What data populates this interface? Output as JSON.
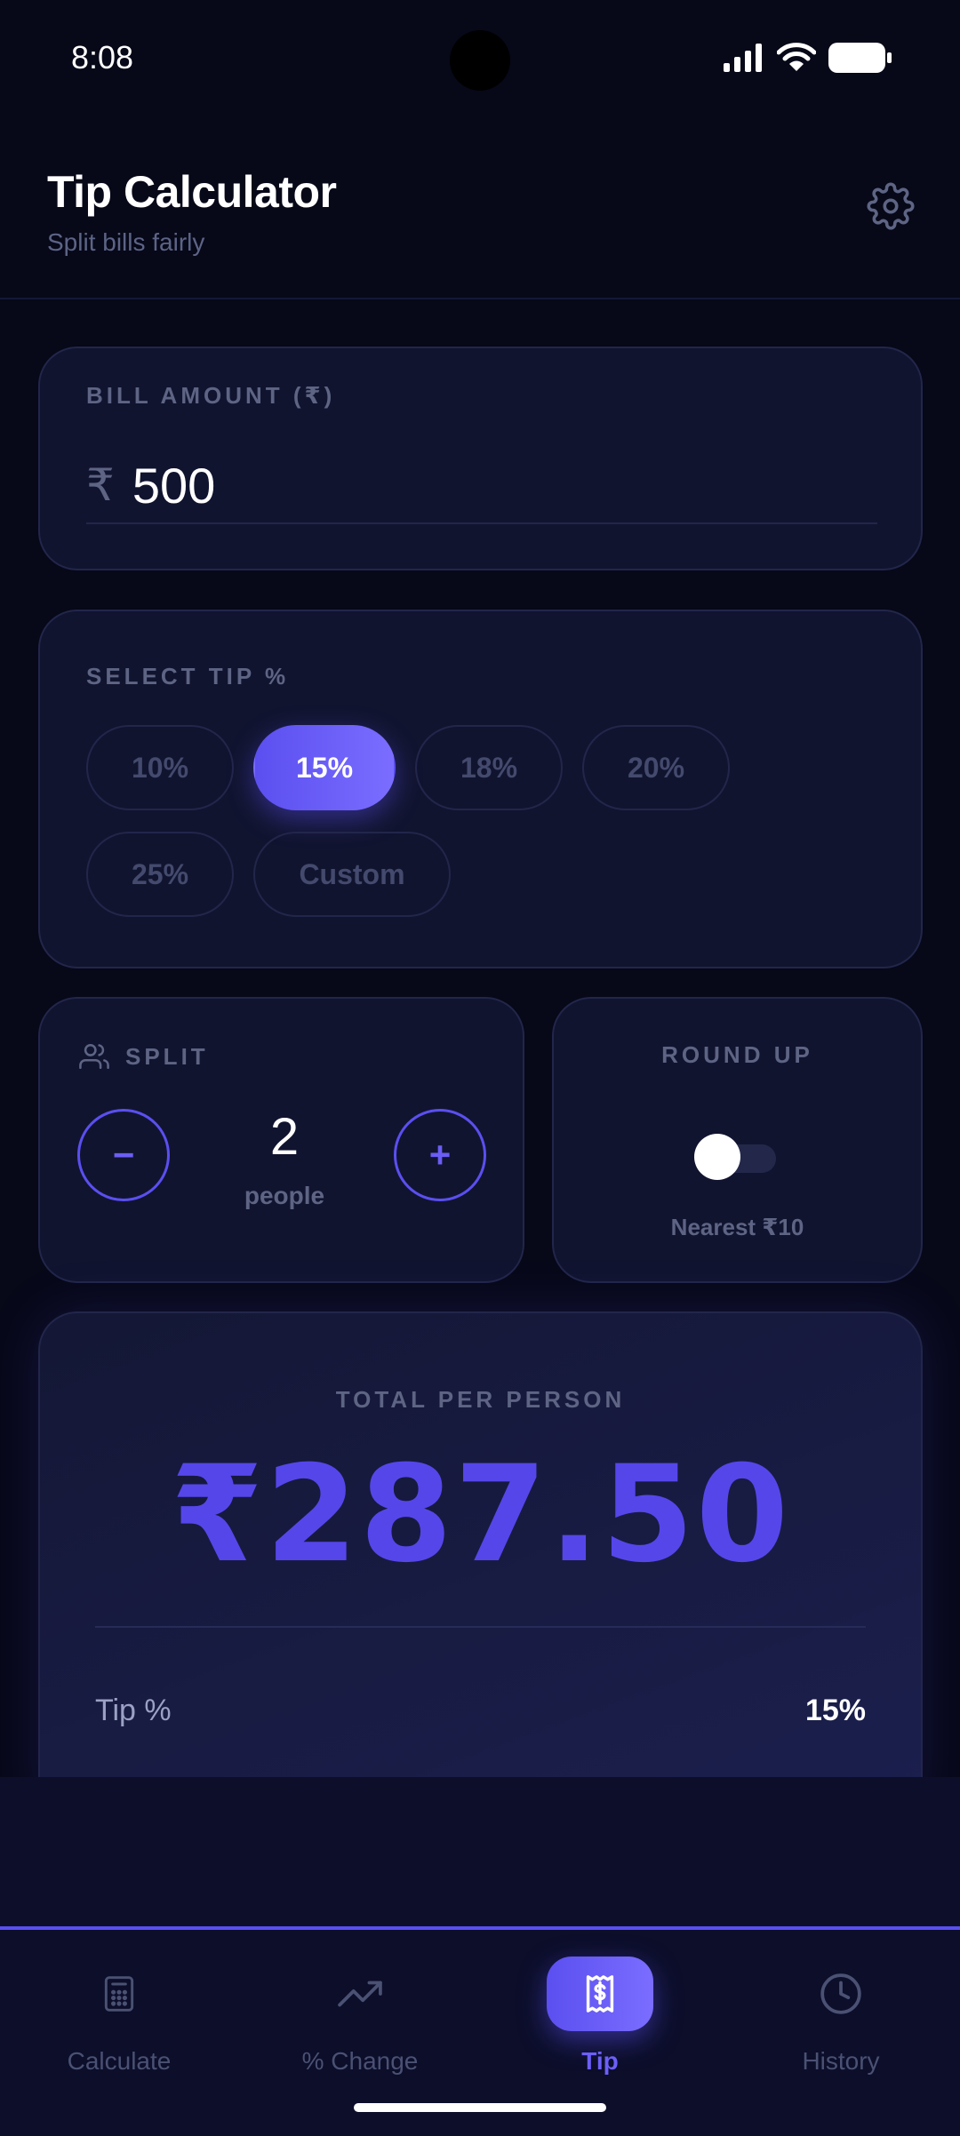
{
  "status_bar": {
    "time": "8:08"
  },
  "header": {
    "title": "Tip Calculator",
    "subtitle": "Split bills fairly"
  },
  "bill": {
    "label": "BILL AMOUNT (₹)",
    "currency_symbol": "₹",
    "value": "500"
  },
  "tip": {
    "label": "SELECT TIP %",
    "options": [
      "10%",
      "15%",
      "18%",
      "20%",
      "25%",
      "Custom"
    ],
    "selected": "15%"
  },
  "split": {
    "label": "SPLIT",
    "minus": "−",
    "plus": "+",
    "count": "2",
    "unit": "people"
  },
  "round_up": {
    "label": "ROUND UP",
    "note": "Nearest ₹10",
    "enabled": false
  },
  "result": {
    "label": "TOTAL PER PERSON",
    "total": "₹287.50",
    "rows": [
      {
        "label": "Tip %",
        "value": "15%"
      }
    ]
  },
  "nav": {
    "items": [
      {
        "label": "Calculate",
        "icon": "calculator-icon"
      },
      {
        "label": "% Change",
        "icon": "trending-up-icon"
      },
      {
        "label": "Tip",
        "icon": "receipt-icon"
      },
      {
        "label": "History",
        "icon": "clock-icon"
      }
    ],
    "active": "Tip"
  },
  "colors": {
    "accent": "#5b4ff0",
    "background": "#070818",
    "card": "#11142f",
    "muted": "#5d6484"
  }
}
